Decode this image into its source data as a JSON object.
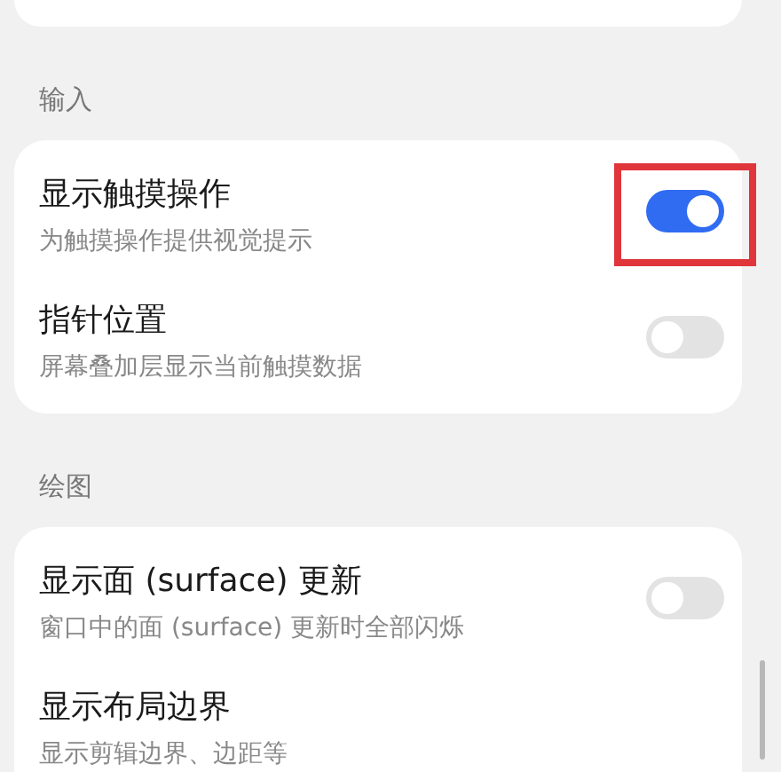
{
  "sections": [
    {
      "title": "输入",
      "items": [
        {
          "kind": "switch",
          "title": "显示触摸操作",
          "subtitle": "为触摸操作提供视觉提示",
          "on": true,
          "highlighted": true
        },
        {
          "kind": "switch",
          "title": "指针位置",
          "subtitle": "屏幕叠加层显示当前触摸数据",
          "on": false,
          "highlighted": false
        }
      ]
    },
    {
      "title": "绘图",
      "items": [
        {
          "kind": "switch",
          "title": "显示面 (surface) 更新",
          "subtitle": "窗口中的面 (surface) 更新时全部闪烁",
          "on": false,
          "highlighted": false
        },
        {
          "kind": "plain",
          "title": "显示布局边界",
          "subtitle": "显示剪辑边界、边距等",
          "highlighted": false
        }
      ]
    }
  ]
}
